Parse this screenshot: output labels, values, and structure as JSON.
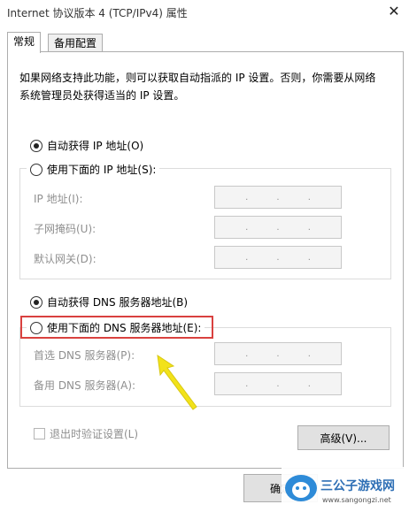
{
  "window": {
    "title": "Internet 协议版本 4 (TCP/IPv4) 属性"
  },
  "tabs": [
    "常规",
    "备用配置"
  ],
  "intro_text": "如果网络支持此功能，则可以获取自动指派的 IP 设置。否则，你需要从网络系统管理员处获得适当的 IP 设置。",
  "ip": {
    "auto_label": "自动获得 IP 地址(O)",
    "auto_checked": true,
    "manual_label": "使用下面的 IP 地址(S):",
    "fields": [
      {
        "label": "IP 地址(I):"
      },
      {
        "label": "子网掩码(U):"
      },
      {
        "label": "默认网关(D):"
      }
    ]
  },
  "dns": {
    "auto_label": "自动获得 DNS 服务器地址(B)",
    "auto_checked": true,
    "manual_label": "使用下面的 DNS 服务器地址(E):",
    "fields": [
      {
        "label": "首选 DNS 服务器(P):"
      },
      {
        "label": "备用 DNS 服务器(A):"
      }
    ]
  },
  "validate_label": "退出时验证设置(L)",
  "advanced_button": "高级(V)...",
  "ok_button": "确定",
  "ip_separator": ".",
  "watermark": {
    "name": "三公子游戏网",
    "url": "www.sangongzi.net"
  },
  "colors": {
    "highlight": "#d9413f",
    "arrow": "#f2e21a"
  }
}
